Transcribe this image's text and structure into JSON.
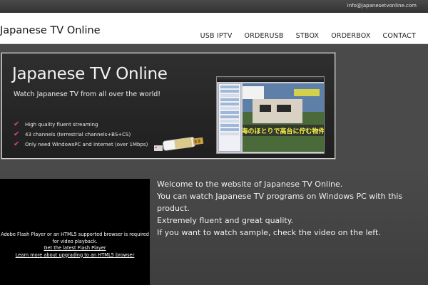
{
  "topbar": {
    "email": "info@japanesetvonline.com"
  },
  "header": {
    "site_title": "Japanese TV Online",
    "nav": [
      "USB IPTV",
      "ORDERUSB",
      "STBOX",
      "ORDERBOX",
      "CONTACT"
    ]
  },
  "banner": {
    "title": "Japanese TV Online",
    "subtitle": "Watch Japanese TV from all over the world!",
    "features": [
      "High quality fluent streaming",
      "43 channels (terrestrial channels+BS+CS)",
      "Only need WindowsPC and Internet (over 1Mbps)"
    ],
    "screen_caption": "海のほとりで高台に佇む物件",
    "accent_color": "#e0409a"
  },
  "video": {
    "message_line1": "Adobe Flash Player or an HTML5 supported browser is required",
    "message_line2": "for video playback.",
    "link_flash": "Get the latest Flash Player",
    "link_html5": "Learn more about upgrading to an HTML5 browser"
  },
  "welcome": {
    "lines": [
      "Welcome to the website of Japanese TV Online.",
      "You can watch Japanese TV programs on Windows PC with this product.",
      "Extremely fluent and great quality.",
      "If you want to watch sample, check the video on the left."
    ]
  }
}
